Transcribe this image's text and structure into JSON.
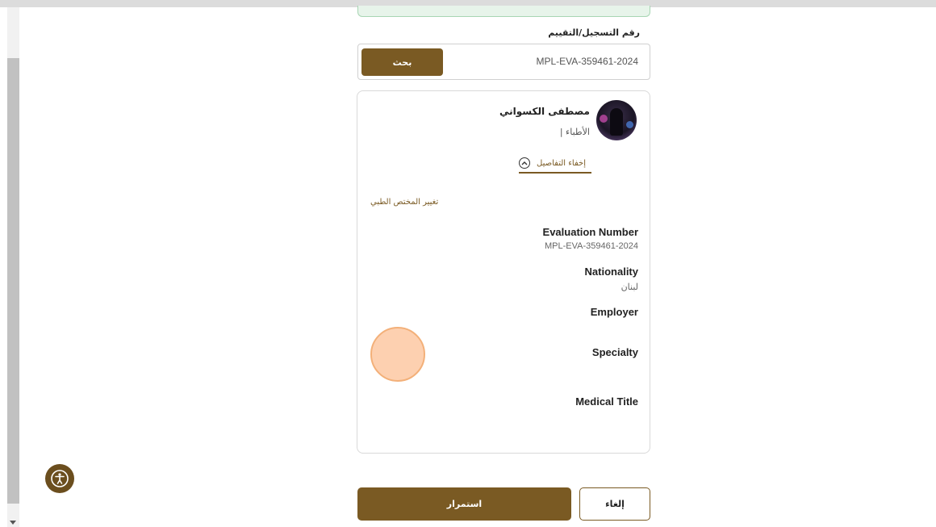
{
  "search": {
    "label": "رقم التسجيل/التقييم",
    "value": "MPL-EVA-359461-2024",
    "button_label": "بحث"
  },
  "professional": {
    "name": "مصطفى الكسواني",
    "category": "الأطباء |",
    "toggle_details_label": "إخفاء التفاصيل",
    "change_link_label": "تغيير المختص الطبي"
  },
  "details": {
    "evaluation_number_label": "Evaluation Number",
    "evaluation_number_value": "MPL-EVA-359461-2024",
    "nationality_label": "Nationality",
    "nationality_value": "لبنان",
    "employer_label": "Employer",
    "specialty_label": "Specialty",
    "medical_title_label": "Medical Title"
  },
  "actions": {
    "continue_label": "استمرار",
    "cancel_label": "إلغاء"
  },
  "colors": {
    "accent": "#7a5a23",
    "accessibility_button": "#6b4e1e"
  }
}
